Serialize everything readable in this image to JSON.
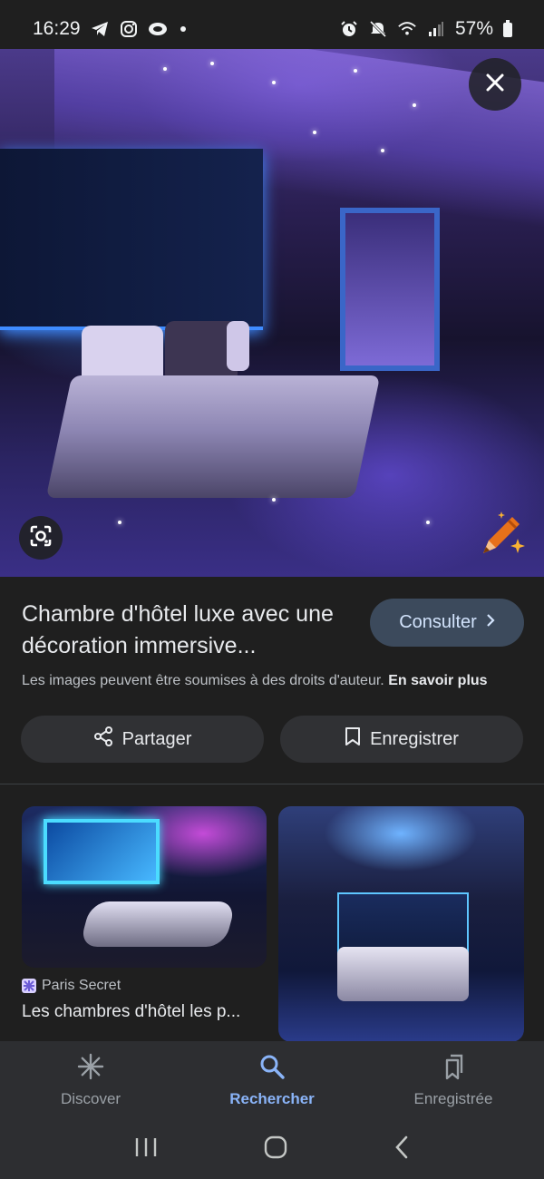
{
  "status_bar": {
    "time": "16:29",
    "battery": "57%",
    "icons_left": [
      "telegram-icon",
      "instagram-icon",
      "snapchat-icon",
      "dot-icon"
    ],
    "icons_right": [
      "alarm-icon",
      "mute-icon",
      "wifi-icon",
      "signal-icon",
      "battery-icon"
    ]
  },
  "viewer": {
    "close_icon": "close-icon",
    "lens_icon": "google-lens-icon",
    "ai_badge_icon": "crayon-icon",
    "title": "Chambre d'hôtel luxe avec une décoration immersive...",
    "visit_label": "Consulter",
    "copyright_text": "Les images peuvent être soumises à des droits d'auteur.",
    "learn_more_label": "En savoir plus",
    "share_label": "Partager",
    "save_label": "Enregistrer"
  },
  "related": [
    {
      "source": "Paris Secret",
      "title": "Les chambres d'hôtel les p..."
    },
    {
      "source": "",
      "title": ""
    }
  ],
  "bottom_nav": {
    "items": [
      {
        "label": "Discover",
        "icon": "asterisk-icon",
        "active": false
      },
      {
        "label": "Rechercher",
        "icon": "search-icon",
        "active": true
      },
      {
        "label": "Enregistrée",
        "icon": "bookmarks-icon",
        "active": false
      }
    ]
  },
  "system_nav": [
    "recents-icon",
    "home-icon",
    "back-icon"
  ],
  "colors": {
    "background": "#1f1f1f",
    "accent": "#8ab4f8",
    "visit_button": "#3c4a5c",
    "action_button": "#303134"
  }
}
